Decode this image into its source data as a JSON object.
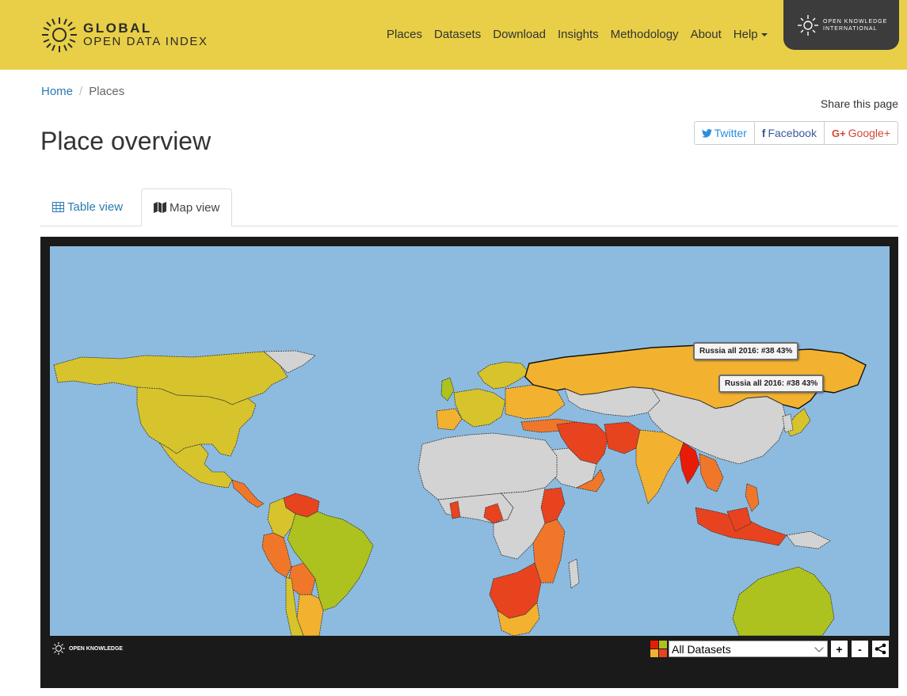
{
  "brand": {
    "line1": "GLOBAL",
    "line2": "OPEN DATA INDEX"
  },
  "nav": {
    "items": [
      {
        "label": "Places"
      },
      {
        "label": "Datasets"
      },
      {
        "label": "Download"
      },
      {
        "label": "Insights"
      },
      {
        "label": "Methodology"
      },
      {
        "label": "About"
      },
      {
        "label": "Help"
      }
    ]
  },
  "okfn": {
    "line1": "OPEN KNOWLEDGE",
    "line2": "INTERNATIONAL"
  },
  "breadcrumb": {
    "home": "Home",
    "separator": "/",
    "current": "Places"
  },
  "page": {
    "title": "Place overview"
  },
  "share": {
    "label": "Share this page",
    "twitter": "Twitter",
    "facebook": "Facebook",
    "google": "Google+"
  },
  "tabs": {
    "table": "Table view",
    "map": "Map view",
    "active": "map"
  },
  "map": {
    "tooltips": [
      "Russia all 2016: #38 43%",
      "Russia all 2016: #38 43%"
    ],
    "footer_logo": "OPEN KNOWLEDGE",
    "dataset_select": "All Datasets",
    "zoom_in": "+",
    "zoom_out": "-",
    "colors": {
      "ocean": "#8dbbe0",
      "no_data": "#d3d3d3",
      "high": "#adc21e",
      "mid_high": "#d7c42d",
      "mid": "#f2b230",
      "low_mid": "#f0772a",
      "low": "#e8431f",
      "lowest": "#e81b06"
    }
  }
}
